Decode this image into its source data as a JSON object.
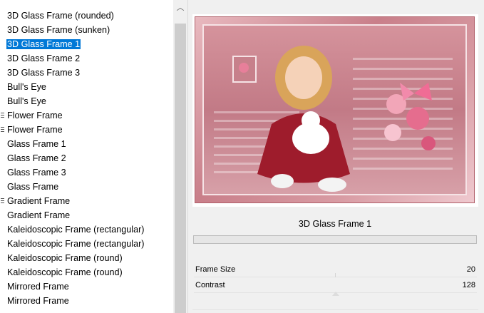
{
  "list": {
    "items": [
      {
        "label": "3D Glass Frame (rounded)",
        "selected": false,
        "grip": false
      },
      {
        "label": "3D Glass Frame (sunken)",
        "selected": false,
        "grip": false
      },
      {
        "label": "3D Glass Frame 1",
        "selected": true,
        "grip": false
      },
      {
        "label": "3D Glass Frame 2",
        "selected": false,
        "grip": false
      },
      {
        "label": "3D Glass Frame 3",
        "selected": false,
        "grip": false
      },
      {
        "label": "Bull's Eye",
        "selected": false,
        "grip": false
      },
      {
        "label": "Bull's Eye",
        "selected": false,
        "grip": false
      },
      {
        "label": "Flower Frame",
        "selected": false,
        "grip": true
      },
      {
        "label": "Flower Frame",
        "selected": false,
        "grip": true
      },
      {
        "label": "Glass Frame 1",
        "selected": false,
        "grip": false
      },
      {
        "label": "Glass Frame 2",
        "selected": false,
        "grip": false
      },
      {
        "label": "Glass Frame 3",
        "selected": false,
        "grip": false
      },
      {
        "label": "Glass Frame",
        "selected": false,
        "grip": false
      },
      {
        "label": "Gradient Frame",
        "selected": false,
        "grip": true
      },
      {
        "label": "Gradient Frame",
        "selected": false,
        "grip": false
      },
      {
        "label": "Kaleidoscopic Frame (rectangular)",
        "selected": false,
        "grip": false
      },
      {
        "label": "Kaleidoscopic Frame (rectangular)",
        "selected": false,
        "grip": false
      },
      {
        "label": "Kaleidoscopic Frame (round)",
        "selected": false,
        "grip": false
      },
      {
        "label": "Kaleidoscopic Frame (round)",
        "selected": false,
        "grip": false
      },
      {
        "label": "Mirrored Frame",
        "selected": false,
        "grip": false
      },
      {
        "label": "Mirrored Frame",
        "selected": false,
        "grip": false
      }
    ]
  },
  "scrollbar": {
    "up_icon": "chevron-up-icon",
    "up_glyph": "︿"
  },
  "preview": {
    "image": "framed girl with white kitten and pink flowers"
  },
  "selected_title": "3D Glass Frame 1",
  "properties": [
    {
      "name": "Frame Size",
      "value": "20"
    },
    {
      "name": "Contrast",
      "value": "128"
    }
  ],
  "colors": {
    "selection": "#0078d7",
    "frame_pink": "#c97f8a"
  }
}
